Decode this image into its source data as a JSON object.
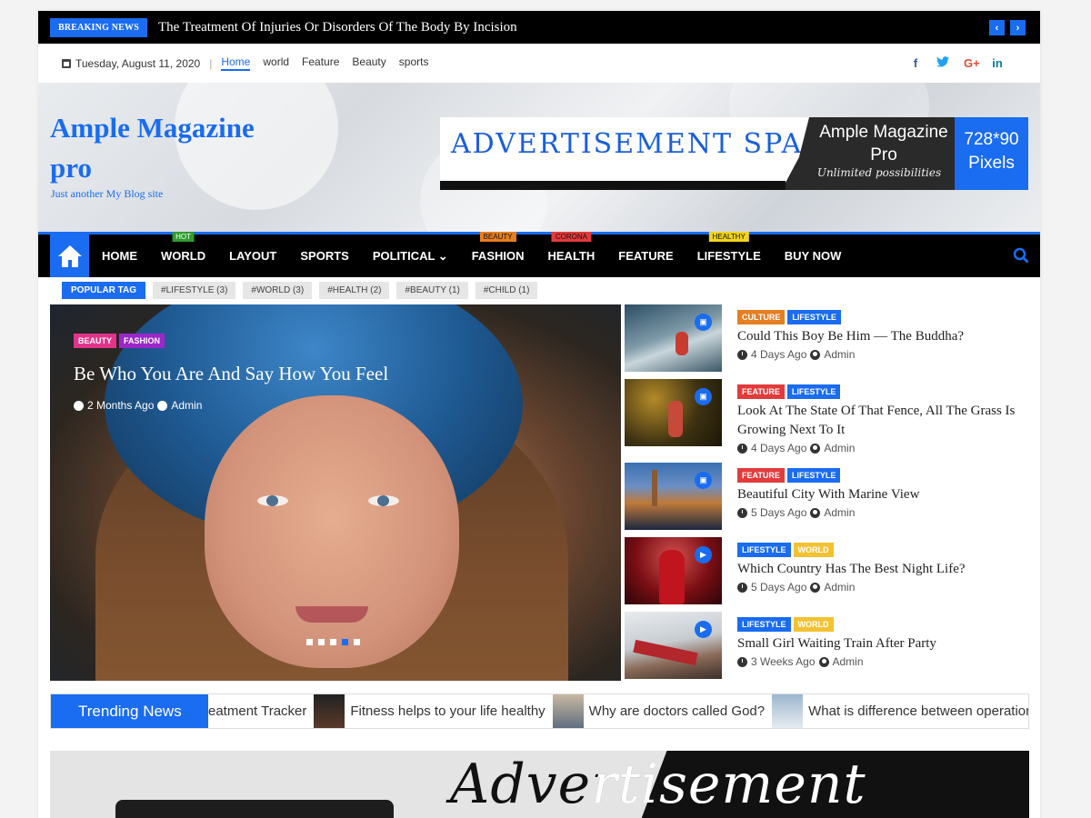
{
  "breaking": {
    "label": "BREAKING NEWS",
    "headline": "The Treatment Of Injuries Or Disorders Of The Body By Incision",
    "prev": "‹",
    "next": "›"
  },
  "topbar": {
    "date": "Tuesday, August 11, 2020",
    "links": [
      "Home",
      "world",
      "Feature",
      "Beauty",
      "sports"
    ],
    "active_link": "Home",
    "social": [
      {
        "icon": "facebook-icon",
        "glyph": "f",
        "color": "#3b5998"
      },
      {
        "icon": "twitter-icon",
        "glyph": "🐦",
        "color": "#1da1f2"
      },
      {
        "icon": "googleplus-icon",
        "glyph": "G+",
        "color": "#dd4b39"
      },
      {
        "icon": "linkedin-icon",
        "glyph": "in",
        "color": "#0e76a8"
      }
    ]
  },
  "header": {
    "site_title": "Ample Magazine pro",
    "site_description": "Just another My Blog site"
  },
  "ad_banner": {
    "text": "ADVERTISEMENT SPACE",
    "product": "Ample Magazine Pro",
    "tagline": "Unlimited possibilities",
    "size": "728*90",
    "unit": "Pixels"
  },
  "nav": {
    "items": [
      {
        "label": "HOME",
        "badge": ""
      },
      {
        "label": "WORLD",
        "badge": "HOT",
        "badge_color": "#2e9e2e"
      },
      {
        "label": "LAYOUT",
        "badge": ""
      },
      {
        "label": "SPORTS",
        "badge": ""
      },
      {
        "label": "POLITICAL ⌄",
        "badge": ""
      },
      {
        "label": "FASHION",
        "badge": "BEAUTY",
        "badge_color": "#e67e22"
      },
      {
        "label": "HEALTH",
        "badge": "CORONA",
        "badge_color": "#e23b3b"
      },
      {
        "label": "FEATURE",
        "badge": ""
      },
      {
        "label": "LIFESTYLE",
        "badge": "HEALTHY",
        "badge_color": "#f1d320"
      },
      {
        "label": "BUY NOW",
        "badge": ""
      }
    ]
  },
  "popular_tags": {
    "label": "POPULAR TAG",
    "tags": [
      "#LIFESTYLE (3)",
      "#WORLD (3)",
      "#HEALTH (2)",
      "#BEAUTY (1)",
      "#CHILD (1)"
    ]
  },
  "slider": {
    "categories": [
      {
        "label": "BEAUTY",
        "color": "#e2338a"
      },
      {
        "label": "FASHION",
        "color": "#9b27c9"
      }
    ],
    "title": "Be Who You Are And Say How You Feel",
    "time": "2 Months Ago",
    "author": "Admin",
    "slide_count": 5,
    "active_slide": 4
  },
  "posts": [
    {
      "cats": [
        {
          "label": "CULTURE",
          "color": "#e67e22"
        },
        {
          "label": "LIFESTYLE",
          "color": "#1a6cf0"
        }
      ],
      "title": "Could This Boy Be Him — The Buddha?",
      "time": "4 Days Ago",
      "author": "Admin",
      "media": "image-icon"
    },
    {
      "cats": [
        {
          "label": "FEATURE",
          "color": "#e23b3b"
        },
        {
          "label": "LIFESTYLE",
          "color": "#1a6cf0"
        }
      ],
      "title": "Look At The State Of That Fence, All The Grass Is Growing Next To It",
      "time": "4 Days Ago",
      "author": "Admin",
      "media": "image-icon"
    },
    {
      "cats": [
        {
          "label": "FEATURE",
          "color": "#e23b3b"
        },
        {
          "label": "LIFESTYLE",
          "color": "#1a6cf0"
        }
      ],
      "title": "Beautiful City With Marine View",
      "time": "5 Days Ago",
      "author": "Admin",
      "media": "image-icon"
    },
    {
      "cats": [
        {
          "label": "LIFESTYLE",
          "color": "#1a6cf0"
        },
        {
          "label": "WORLD",
          "color": "#f1c232"
        }
      ],
      "title": "Which Country Has The Best Night Life?",
      "time": "5 Days Ago",
      "author": "Admin",
      "media": "video-icon"
    },
    {
      "cats": [
        {
          "label": "LIFESTYLE",
          "color": "#1a6cf0"
        },
        {
          "label": "WORLD",
          "color": "#f1c232"
        }
      ],
      "title": "Small Girl Waiting Train After Party",
      "time": "3 Weeks Ago",
      "author": "Admin",
      "media": "video-icon"
    }
  ],
  "trending": {
    "label": "Trending News",
    "items": [
      "eatment Tracker",
      "Fitness helps to your life healthy",
      "Why are doctors called God?",
      "What is difference between operation"
    ]
  },
  "bottom_ad": {
    "text": "Advertisement"
  }
}
